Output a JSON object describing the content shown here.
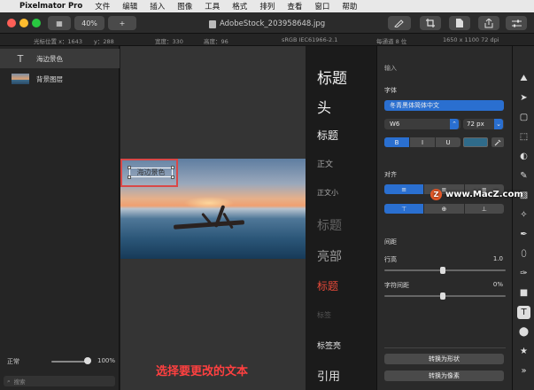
{
  "menubar": {
    "apple_glyph": "",
    "app_name": "Pixelmator Pro",
    "items": [
      "文件",
      "编辑",
      "插入",
      "图像",
      "工具",
      "格式",
      "排列",
      "查看",
      "窗口",
      "帮助"
    ]
  },
  "toolbar": {
    "view_glyph": "▦",
    "zoom": "40%",
    "add_glyph": "+",
    "doc_title": "AdobeStock_203958648.jpg"
  },
  "infobar": {
    "cursor_label": "光标位置 x：1643",
    "cursor_y": "y：288",
    "width": "宽度：330",
    "height": "高度：96",
    "color_profile": "sRGB IEC61966-2.1",
    "bit_depth": "每通道 8 位",
    "doc_size": "1650 x 1100 72 dpi"
  },
  "layers": {
    "items": [
      {
        "label": "海边景色",
        "kind": "text"
      },
      {
        "label": "背景图层",
        "kind": "image"
      }
    ],
    "text_layer_glyph": "T",
    "blend_mode": "正常",
    "opacity": "100%",
    "search_placeholder": "搜索",
    "search_glyph": "⌕"
  },
  "canvas": {
    "text_content": "海边景色",
    "caption": "选择要更改的文本"
  },
  "presets": {
    "items": [
      "标题",
      "头",
      "标题",
      "正文",
      "正文小",
      "标题",
      "亮部",
      "标题",
      "标签",
      "标签亮",
      "引用"
    ]
  },
  "inspector": {
    "input_label": "输入",
    "font_section": "字体",
    "font_family": "冬青黑体简体中文",
    "font_weight": "W6",
    "font_size": "72 px",
    "style_bold": "B",
    "style_italic": "I",
    "style_underline": "U",
    "align_section": "对齐",
    "spacing_section": "间距",
    "line_height_label": "行高",
    "line_height_value": "1.0",
    "letter_spacing_label": "字符间距",
    "letter_spacing_value": "0%",
    "convert_shape": "转换为形状",
    "convert_pixels": "转换为像素",
    "text_color": "#2f6b8a",
    "weight_glyph": "⌃",
    "size_glyph": "⌄",
    "align_left_glyph": "≡",
    "align_center_glyph": "≡",
    "align_right_glyph": "≡",
    "valign_top_glyph": "⊤",
    "valign_middle_glyph": "⊕",
    "valign_bottom_glyph": "⊥"
  },
  "watermark": {
    "logo_glyph": "Z",
    "text": "www.MacZ.com"
  },
  "tools": {
    "glyphs": [
      "⛰",
      "➤",
      "▢",
      "⬚",
      "◐",
      "✎",
      "▧",
      "✧",
      "✒",
      "⬯",
      "✑",
      "■",
      "T",
      "⬤",
      "★",
      "»"
    ]
  },
  "colors": {
    "accent": "#2a6fd0",
    "caption": "#ff4040",
    "text_color_swatch": "#2f6b8a"
  }
}
